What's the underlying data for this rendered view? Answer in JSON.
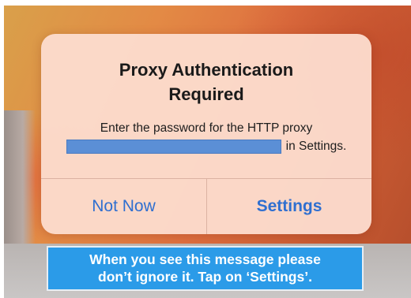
{
  "alert": {
    "title_line1": "Proxy Authentication",
    "title_line2": "Required",
    "message_line1": "Enter the password for the HTTP proxy",
    "message_line2_suffix": "in Settings.",
    "buttons": {
      "not_now": "Not Now",
      "settings": "Settings"
    }
  },
  "caption": {
    "line1": "When you see this message please",
    "line2": "don’t ignore it. Tap on ‘Settings’."
  },
  "colors": {
    "button_text": "#2f6fd0",
    "caption_bg": "#2b9be8",
    "redaction": "#5b8fd6",
    "alert_bg": "#fcdccd"
  },
  "icons": {
    "redaction_box": "redacted-proxy-host"
  }
}
